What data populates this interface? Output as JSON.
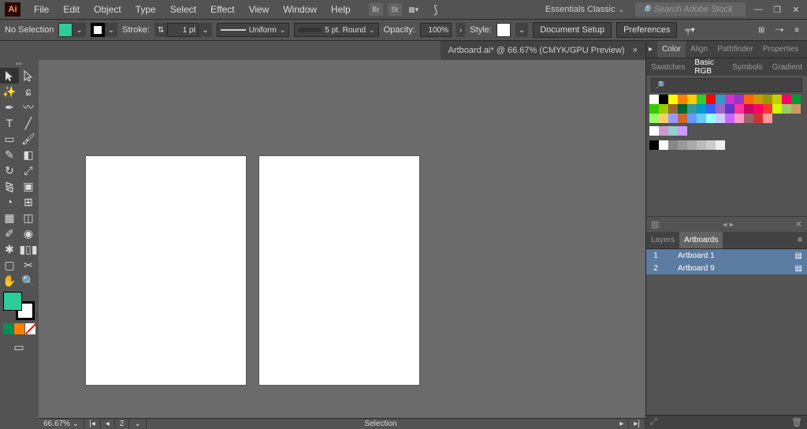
{
  "app": {
    "logo": "Ai"
  },
  "menu": [
    "File",
    "Edit",
    "Object",
    "Type",
    "Select",
    "Effect",
    "View",
    "Window",
    "Help"
  ],
  "workspace": "Essentials Classic",
  "search_stock_placeholder": "Search Adobe Stock",
  "control": {
    "no_selection": "No Selection",
    "fill_color": "#2ecc9b",
    "stroke_color": "#000000",
    "stroke_label": "Stroke:",
    "stroke_weight": "1 pt",
    "profile": "Uniform",
    "brush": "5 pt. Round",
    "opacity_label": "Opacity:",
    "opacity_value": "100%",
    "style_label": "Style:",
    "document_setup": "Document Setup",
    "preferences": "Preferences"
  },
  "doc_tab": "Artboard.ai* @ 66.67% (CMYK/GPU Preview)",
  "status": {
    "zoom": "66.67%",
    "page": "2",
    "tool": "Selection"
  },
  "panel_color_tabs": [
    "Color",
    "Align",
    "Pathfinder",
    "Properties"
  ],
  "panel_swatch_tabs": [
    "Swatches",
    "Basic RGB",
    "Symbols",
    "Gradient"
  ],
  "panel_layer_tabs": [
    "Layers",
    "Artboards"
  ],
  "artboards": [
    {
      "n": "1",
      "name": "Artboard 1"
    },
    {
      "n": "2",
      "name": "Artboard 9"
    }
  ],
  "swatch_colors": [
    "#ffffff",
    "#000000",
    "#ffff00",
    "#ff7f00",
    "#ffcc00",
    "#33cc33",
    "#ff0000",
    "#3399cc",
    "#cc33cc",
    "#9933cc",
    "#ff6600",
    "#cc9900",
    "#999900",
    "#cccc00",
    "#ff0066",
    "#009933",
    "#33cc00",
    "#99cc00",
    "#996633",
    "#006633",
    "#339999",
    "#0099cc",
    "#3366ff",
    "#9966cc",
    "#6633cc",
    "#ff3399",
    "#cc0066",
    "#ff0066",
    "#ff3333",
    "#ccff00",
    "#99cc66",
    "#cc9966",
    "#99ff66",
    "#ffcc66",
    "#9999ff",
    "#cc6633",
    "#6699ff",
    "#66ccff",
    "#99ffff",
    "#ccccff",
    "#cc66ff",
    "#ff99cc",
    "#996666",
    "#cc3333",
    "#ff9999"
  ],
  "tint_colors": [
    "#ffffff",
    "#cc99cc",
    "#99cccc",
    "#cc99ff"
  ],
  "grayscale_colors": [
    "#000000",
    "#ffffff",
    "#888888",
    "#999999",
    "#aaaaaa",
    "#bbbbbb",
    "#cccccc",
    "#eeeeee"
  ]
}
